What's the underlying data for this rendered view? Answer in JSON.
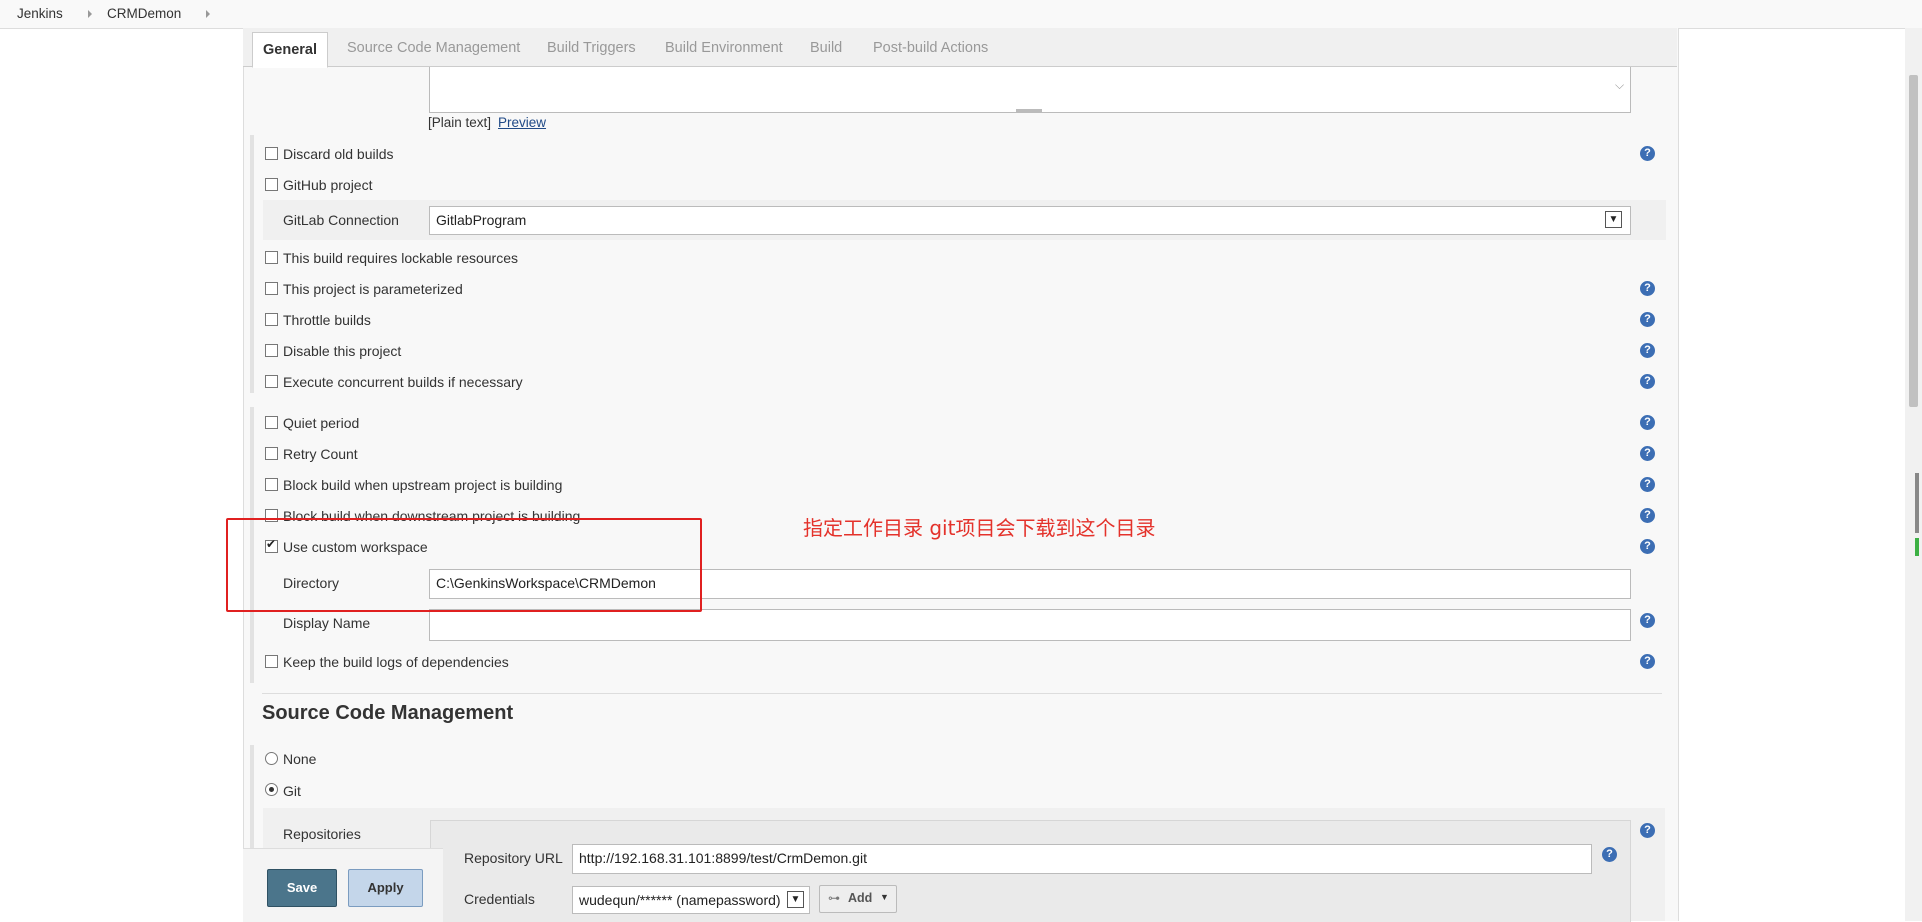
{
  "breadcrumb": {
    "items": [
      "Jenkins",
      "CRMDemon"
    ]
  },
  "tabs": [
    "General",
    "Source Code Management",
    "Build Triggers",
    "Build Environment",
    "Build",
    "Post-build Actions"
  ],
  "description": {
    "plain_text": "[Plain text]",
    "preview_link": "Preview"
  },
  "general_options": {
    "discard_old_builds": "Discard old builds",
    "github_project": "GitHub project",
    "gitlab_connection_label": "GitLab Connection",
    "gitlab_connection_value": "GitlabProgram",
    "lockable_resources": "This build requires lockable resources",
    "parameterized": "This project is parameterized",
    "throttle_builds": "Throttle builds",
    "disable_project": "Disable this project",
    "concurrent_builds": "Execute concurrent builds if necessary"
  },
  "advanced_options": {
    "quiet_period": "Quiet period",
    "retry_count": "Retry Count",
    "block_upstream": "Block build when upstream project is building",
    "block_downstream": "Block build when downstream project is building",
    "custom_workspace": "Use custom workspace",
    "directory_label": "Directory",
    "directory_value": "C:\\GenkinsWorkspace\\CRMDemon",
    "display_name_label": "Display Name",
    "display_name_value": "",
    "keep_logs": "Keep the build logs of dependencies"
  },
  "annotation": "指定工作目录  git项目会下载到这个目录",
  "scm": {
    "title": "Source Code Management",
    "none_label": "None",
    "git_label": "Git",
    "repositories_label": "Repositories",
    "repo_url_label": "Repository URL",
    "repo_url_value": "http://192.168.31.101:8899/test/CrmDemon.git",
    "credentials_label": "Credentials",
    "credentials_value": "wudequn/****** (namepassword)",
    "add_button": "Add"
  },
  "buttons": {
    "save": "Save",
    "apply": "Apply"
  },
  "colors": {
    "help_icon": "#3c6eb4",
    "annotation": "#e4322b",
    "save_button": "#4b758b"
  }
}
